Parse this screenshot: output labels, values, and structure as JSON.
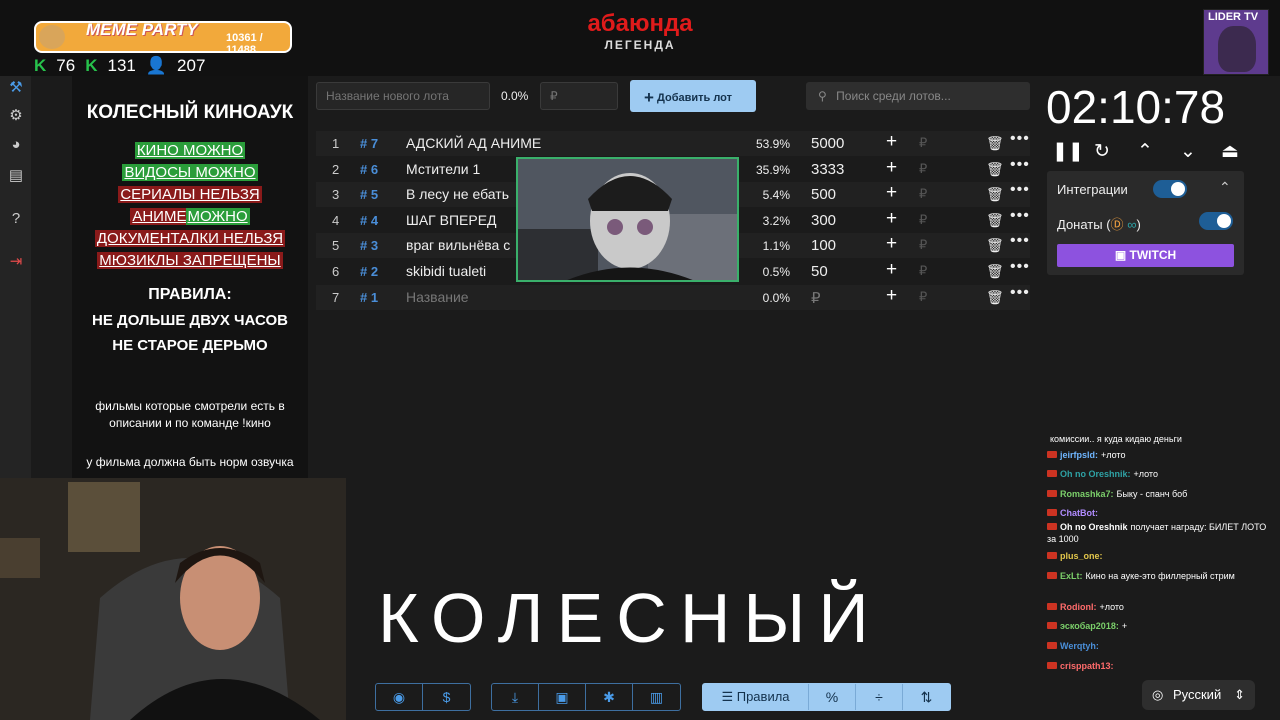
{
  "overlay": {
    "meme_party": {
      "title": "MEME PARTY",
      "counter": "10361 / 11488"
    },
    "stats": {
      "k1": "76",
      "k2": "131",
      "viewers": "207"
    },
    "brand": {
      "title": "абаюнда",
      "subtitle": "ЛЕГЕНДА"
    },
    "lider": "LIDER TV"
  },
  "left_panel": {
    "title": "КОЛЕСНЫЙ КИНОАУК",
    "rules_list": [
      {
        "text": "КИНО МОЖНО",
        "color": "green"
      },
      {
        "text": "ВИДОСЫ МОЖНО",
        "color": "green"
      },
      {
        "text": "СЕРИАЛЫ НЕЛЬЗЯ",
        "color": "red"
      },
      {
        "text_a": "АНИМЕ",
        "text_b": "МОЖНО"
      },
      {
        "text": "ДОКУМЕНТАЛКИ НЕЛЬЗЯ",
        "color": "red"
      },
      {
        "text": "МЮЗИКЛЫ ЗАПРЕЩЕНЫ",
        "color": "red"
      }
    ],
    "rules_heading": "ПРАВИЛА:",
    "rule1": "НЕ ДОЛЬШЕ ДВУХ ЧАСОВ",
    "rule2": "НЕ СТАРОЕ ДЕРЬМО",
    "note1": "фильмы которые смотрели есть в описании и по команде !кино",
    "note2": "у фильма должна быть норм озвучка"
  },
  "toolbar": {
    "new_lot_placeholder": "Название нового лота",
    "percent": "0.0%",
    "amount_placeholder": "₽",
    "add_label": "Добавить лот",
    "search_placeholder": "Поиск среди лотов..."
  },
  "lots": [
    {
      "n": "1",
      "id": "# 7",
      "name": "АДСКИЙ АД АНИМЕ",
      "pct": "53.9%",
      "amount": "5000"
    },
    {
      "n": "2",
      "id": "# 6",
      "name": "Мстители 1",
      "pct": "35.9%",
      "amount": "3333"
    },
    {
      "n": "3",
      "id": "# 5",
      "name": "В лесу не ебать",
      "pct": "5.4%",
      "amount": "500"
    },
    {
      "n": "4",
      "id": "# 4",
      "name": "ШАГ ВПЕРЕД",
      "pct": "3.2%",
      "amount": "300"
    },
    {
      "n": "5",
      "id": "# 3",
      "name": "враг вильнёва с",
      "pct": "1.1%",
      "amount": "100"
    },
    {
      "n": "6",
      "id": "# 2",
      "name": "skibidi tualeti",
      "pct": "0.5%",
      "amount": "50"
    },
    {
      "n": "7",
      "id": "# 1",
      "name": "Название",
      "pct": "0.0%",
      "amount": "₽"
    }
  ],
  "currency": "₽",
  "timer": "02:10:78",
  "integrations": {
    "label": "Интеграции",
    "donations": "Донаты (",
    "donations_close": ")",
    "twitch": "TWITCH"
  },
  "chat": [
    {
      "user": "",
      "text": "комиссии.. я куда кидаю деньги",
      "color": "#ffffff"
    },
    {
      "user": "jeirfpsld:",
      "text": "+лото",
      "color": "#6fb6ff"
    },
    {
      "user": "Oh no Oreshnik:",
      "text": "+лото",
      "color": "#2ea2a5"
    },
    {
      "user": "Romashka7:",
      "text": "Быку - спанч боб",
      "color": "#7bcf6a"
    },
    {
      "user": "ChatBot:",
      "text": "",
      "color": "#b18cff"
    },
    {
      "user": "Oh no Oreshnik",
      "text": "получает награду: БИЛЕТ ЛОТО за 1000",
      "color": "#ffffff"
    },
    {
      "user": "plus_one:",
      "text": "",
      "color": "#e3c74b"
    },
    {
      "user": "ExLt:",
      "text": "Кино на ауке-это филлерный стрим",
      "color": "#7bcf6a"
    },
    {
      "user": "RodionI:",
      "text": "+лото",
      "color": "#ff6b6b"
    },
    {
      "user": "эскобар2018:",
      "text": "+",
      "color": "#7bcf6a"
    },
    {
      "user": "Werqtyh:",
      "text": "",
      "color": "#4a8ed8"
    },
    {
      "user": "crisppath13:",
      "text": "",
      "color": "#ff6b6b"
    }
  ],
  "big_word": "КОЛЕСНЫЙ",
  "bottom": {
    "rules_label": "Правила"
  },
  "language": "Русский",
  "colors": {
    "accent": "#9ecbf2",
    "twitch": "#8d52df",
    "brand_red": "#e01b1b"
  }
}
